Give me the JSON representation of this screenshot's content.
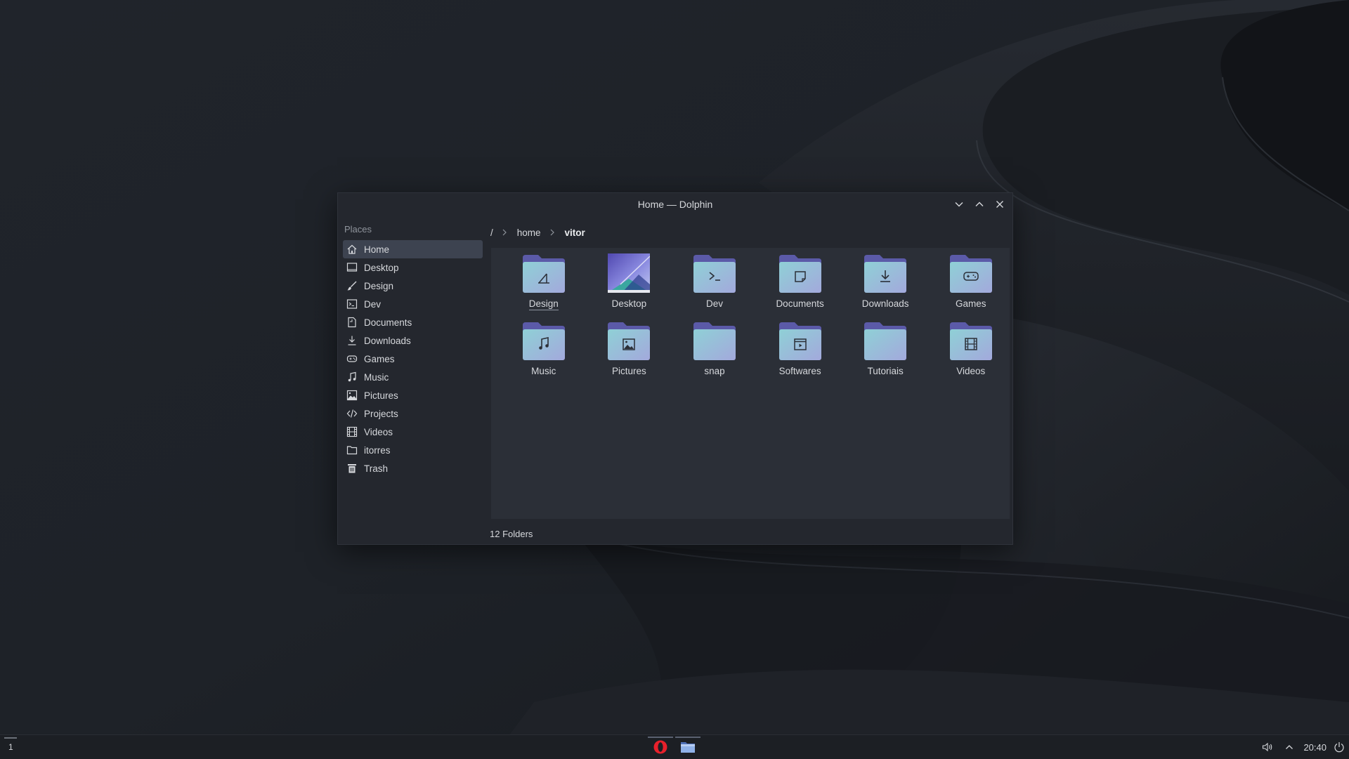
{
  "window": {
    "title": "Home — Dolphin"
  },
  "sidebar": {
    "heading": "Places",
    "items": [
      {
        "label": "Home",
        "icon": "home-icon",
        "active": true
      },
      {
        "label": "Desktop",
        "icon": "desktop-icon"
      },
      {
        "label": "Design",
        "icon": "brush-icon"
      },
      {
        "label": "Dev",
        "icon": "terminal-icon"
      },
      {
        "label": "Documents",
        "icon": "document-icon"
      },
      {
        "label": "Downloads",
        "icon": "download-icon"
      },
      {
        "label": "Games",
        "icon": "gamepad-icon"
      },
      {
        "label": "Music",
        "icon": "music-note-icon"
      },
      {
        "label": "Pictures",
        "icon": "picture-icon"
      },
      {
        "label": "Projects",
        "icon": "code-icon"
      },
      {
        "label": "Videos",
        "icon": "film-icon"
      },
      {
        "label": "itorres",
        "icon": "folder-icon"
      },
      {
        "label": "Trash",
        "icon": "trash-icon"
      }
    ]
  },
  "breadcrumb": {
    "root": "/",
    "parts": [
      "home",
      "vitor"
    ]
  },
  "files": [
    {
      "name": "Design",
      "icon": "design-icon"
    },
    {
      "name": "Desktop",
      "icon": "desktop-thumbnail"
    },
    {
      "name": "Dev",
      "icon": "terminal-icon"
    },
    {
      "name": "Documents",
      "icon": "document-icon"
    },
    {
      "name": "Downloads",
      "icon": "download-icon"
    },
    {
      "name": "Games",
      "icon": "gamepad-icon"
    },
    {
      "name": "Music",
      "icon": "music-note-icon"
    },
    {
      "name": "Pictures",
      "icon": "picture-icon"
    },
    {
      "name": "snap",
      "icon": "folder-icon"
    },
    {
      "name": "Softwares",
      "icon": "software-icon"
    },
    {
      "name": "Tutoriais",
      "icon": "folder-icon"
    },
    {
      "name": "Videos",
      "icon": "film-icon"
    }
  ],
  "status": {
    "text": "12 Folders"
  },
  "taskbar": {
    "desktop_number": "1",
    "apps": [
      {
        "name": "Opera",
        "icon": "opera-icon",
        "color": "#e8202b"
      },
      {
        "name": "Dolphin",
        "icon": "folder-manager-icon",
        "color": "#6c8fd0"
      }
    ],
    "clock": "20:40"
  },
  "colors": {
    "folder_top": "#5b5aa8",
    "folder_front_light": "#8fd0d6",
    "folder_front_dark": "#a3a9dc",
    "accent_selection": "#3d4350"
  }
}
